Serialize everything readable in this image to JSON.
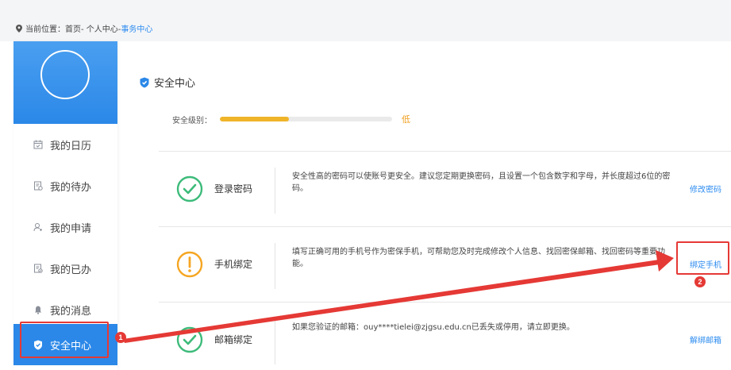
{
  "breadcrumb": {
    "prefix": "当前位置：",
    "path": "首页- 个人中心-",
    "current": " 事务中心"
  },
  "sidebar": {
    "items": [
      {
        "label": "我的日历",
        "icon": "calendar-icon"
      },
      {
        "label": "我的待办",
        "icon": "todo-icon"
      },
      {
        "label": "我的申请",
        "icon": "user-apply-icon"
      },
      {
        "label": "我的已办",
        "icon": "done-icon"
      },
      {
        "label": "我的消息",
        "icon": "bell-icon"
      },
      {
        "label": "安全中心",
        "icon": "shield-icon"
      }
    ],
    "active_index": 5
  },
  "security": {
    "title": "安全中心",
    "level_label": "安全级别：",
    "level_text": "低",
    "level_fraction": 0.4,
    "level_color": "#f0b429"
  },
  "cards": [
    {
      "name": "登录密码",
      "status": "ok",
      "desc": "安全性高的密码可以使账号更安全。建议您定期更换密码，且设置一个包含数字和字母，并长度超过6位的密码。",
      "action": "修改密码"
    },
    {
      "name": "手机绑定",
      "status": "warning",
      "desc": "填写正确可用的手机号作为密保手机，可帮助您及时完成修改个人信息、找回密保邮箱、找回密码等重要功能。",
      "action": "绑定手机"
    },
    {
      "name": "邮箱绑定",
      "status": "ok",
      "desc": "如果您验证的邮箱：ouy****tielei@zjgsu.edu.cn已丢失或停用，请立即更换。",
      "action": "解绑邮箱"
    }
  ],
  "annotations": {
    "badge_1": "1",
    "badge_2": "2"
  },
  "colors": {
    "accent": "#2b88e8",
    "link": "#2d8cf0",
    "success": "#3dbb7a",
    "warning": "#f5a623",
    "annotation": "#e53935"
  }
}
